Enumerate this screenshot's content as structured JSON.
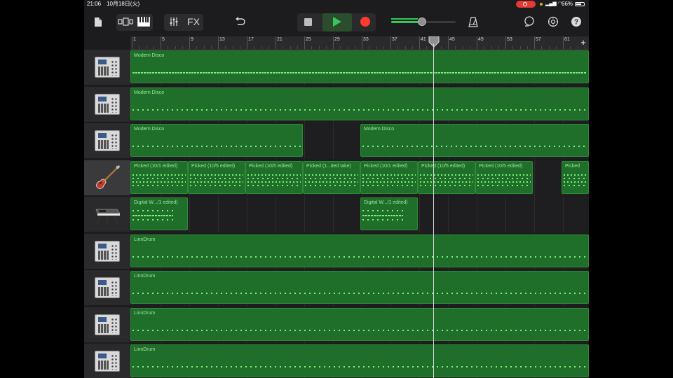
{
  "status_bar": {
    "time": "21:06",
    "date": "10月18日(火)",
    "battery": "66%"
  },
  "toolbar": {
    "fx_label": "FX",
    "colors": {
      "play": "#34c759",
      "record": "#ff3b30"
    }
  },
  "ruler": {
    "bars": [
      "1",
      "5",
      "9",
      "13",
      "17",
      "21",
      "25",
      "29",
      "33",
      "37",
      "41",
      "45",
      "49",
      "53",
      "57",
      "61"
    ],
    "add_label": "+"
  },
  "tracks": [
    {
      "instrument": "drum-machine",
      "regions": [
        {
          "label": "Modern Disco"
        }
      ]
    },
    {
      "instrument": "drum-machine",
      "regions": [
        {
          "label": "Modern Disco"
        }
      ]
    },
    {
      "instrument": "drum-machine",
      "regions": [
        {
          "label": "Modern Disco"
        },
        {
          "label": "Modern Disco"
        }
      ]
    },
    {
      "instrument": "bass-guitar",
      "selected": true,
      "regions": [
        {
          "label": "Picked (10/1 edited)"
        },
        {
          "label": "Picked (10/5 edited)"
        },
        {
          "label": "Picked (10/5 edited)"
        },
        {
          "label": "Picked (1...ited take)"
        },
        {
          "label": "Picked (10/1 edited)"
        },
        {
          "label": "Picked (10/5 edited)"
        },
        {
          "label": "Picked (10/5 edited)"
        },
        {
          "label": "Picked"
        }
      ]
    },
    {
      "instrument": "keyboard-synth",
      "regions": [
        {
          "label": "Digital W.../1 edited)"
        },
        {
          "label": "Digital W.../1 edited)"
        }
      ]
    },
    {
      "instrument": "drum-machine",
      "regions": [
        {
          "label": "LinnDrum"
        }
      ]
    },
    {
      "instrument": "drum-machine",
      "regions": [
        {
          "label": "LinnDrum"
        }
      ]
    },
    {
      "instrument": "drum-machine",
      "regions": [
        {
          "label": "LinnDrum"
        }
      ]
    },
    {
      "instrument": "drum-machine",
      "regions": [
        {
          "label": "LinnDrum"
        }
      ]
    }
  ]
}
